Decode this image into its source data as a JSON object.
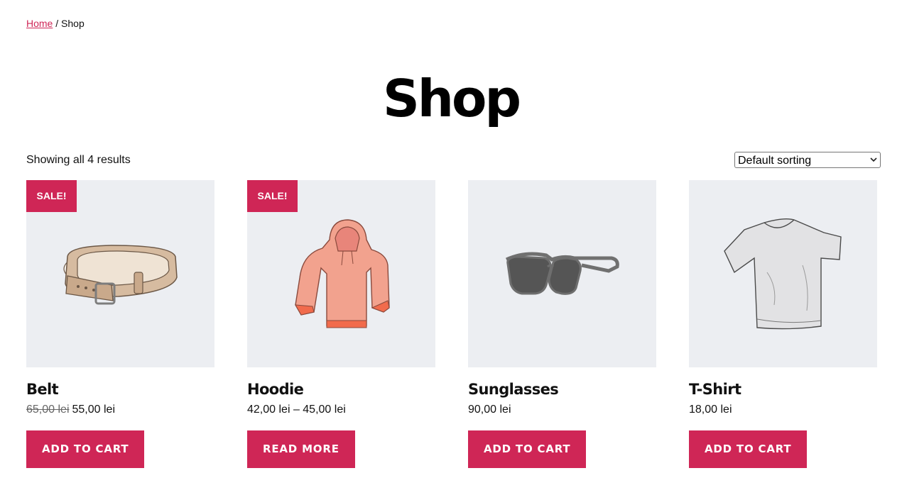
{
  "breadcrumb": {
    "home": "Home",
    "separator": " / ",
    "current": "Shop"
  },
  "page_title": "Shop",
  "result_count": "Showing all 4 results",
  "ordering": {
    "selected": "Default sorting"
  },
  "colors": {
    "accent": "#cf2656",
    "thumb_bg": "#eceef2"
  },
  "products": [
    {
      "name": "Belt",
      "badge": "SALE!",
      "price_old": "65,00 lei",
      "price": "55,00 lei",
      "button": "ADD TO CART",
      "icon": "belt-image"
    },
    {
      "name": "Hoodie",
      "badge": "SALE!",
      "price": "42,00 lei – 45,00 lei",
      "button": "READ MORE",
      "icon": "hoodie-image"
    },
    {
      "name": "Sunglasses",
      "price": "90,00 lei",
      "button": "ADD TO CART",
      "icon": "sunglasses-image"
    },
    {
      "name": "T-Shirt",
      "price": "18,00 lei",
      "button": "ADD TO CART",
      "icon": "tshirt-image"
    }
  ]
}
